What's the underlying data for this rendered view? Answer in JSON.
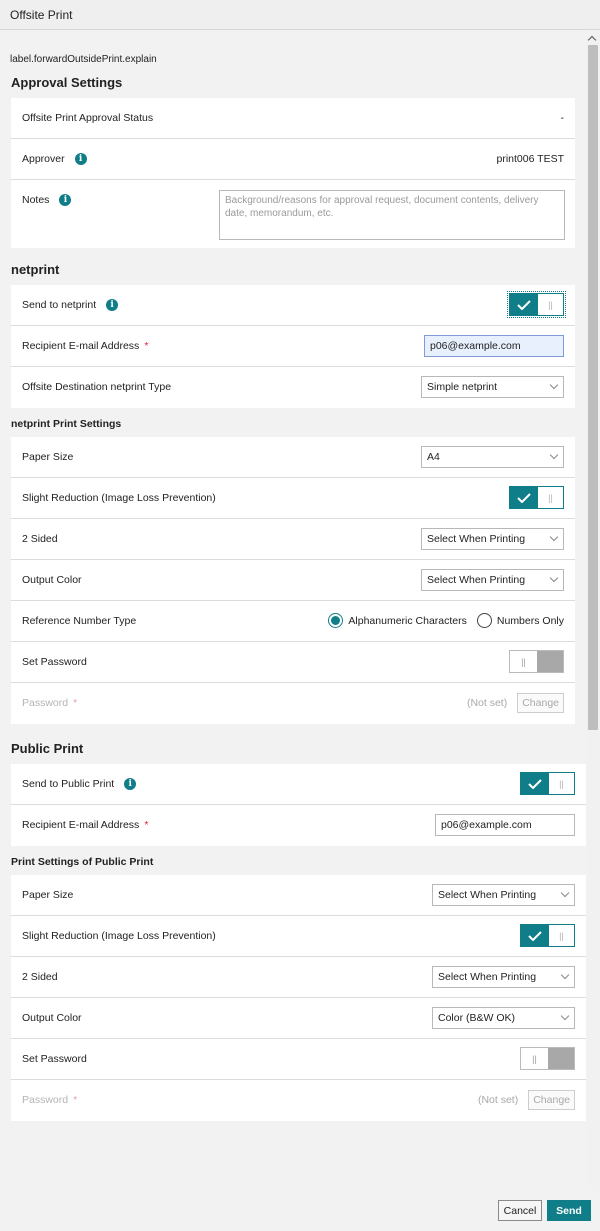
{
  "window": {
    "title": "Offsite Print"
  },
  "explain": "label.forwardOutsidePrint.explain",
  "approval": {
    "heading": "Approval Settings",
    "status_label": "Offsite Print Approval Status",
    "status_value": "-",
    "approver_label": "Approver",
    "approver_value": "print006 TEST",
    "notes_label": "Notes",
    "notes_placeholder": "Background/reasons for approval request, document contents, delivery date, memorandum, etc."
  },
  "netprint": {
    "heading": "netprint",
    "send_label": "Send to netprint",
    "send_toggle": "on",
    "email_label": "Recipient E-mail Address",
    "email_value": "p06@example.com",
    "type_label": "Offsite Destination netprint Type",
    "type_value": "Simple netprint"
  },
  "netprint_settings": {
    "heading": "netprint Print Settings",
    "paper_label": "Paper Size",
    "paper_value": "A4",
    "reduction_label": "Slight Reduction (Image Loss Prevention)",
    "reduction_toggle": "on",
    "sided_label": "2 Sided",
    "sided_value": "Select When Printing",
    "color_label": "Output Color",
    "color_value": "Select When Printing",
    "ref_label": "Reference Number Type",
    "ref_options": [
      "Alphanumeric Characters",
      "Numbers Only"
    ],
    "ref_selected": "Alphanumeric Characters",
    "setpw_label": "Set Password",
    "setpw_toggle": "off",
    "pw_label": "Password",
    "pw_value": "(Not set)",
    "pw_change": "Change"
  },
  "public": {
    "heading": "Public Print",
    "send_label": "Send to Public Print",
    "send_toggle": "on",
    "email_label": "Recipient E-mail Address",
    "email_value": "p06@example.com"
  },
  "public_settings": {
    "heading": "Print Settings of Public Print",
    "paper_label": "Paper Size",
    "paper_value": "Select When Printing",
    "reduction_label": "Slight Reduction (Image Loss Prevention)",
    "reduction_toggle": "on",
    "sided_label": "2 Sided",
    "sided_value": "Select When Printing",
    "color_label": "Output Color",
    "color_value": "Color (B&W OK)",
    "setpw_label": "Set Password",
    "setpw_toggle": "off",
    "pw_label": "Password",
    "pw_value": "(Not set)",
    "pw_change": "Change"
  },
  "footer": {
    "cancel": "Cancel",
    "send": "Send"
  },
  "colors": {
    "accent": "#107e88",
    "required": "#d4213d"
  },
  "icons": [
    "info-icon",
    "checkmark-icon",
    "chevron-down-icon",
    "scroll-up-arrow-icon"
  ]
}
